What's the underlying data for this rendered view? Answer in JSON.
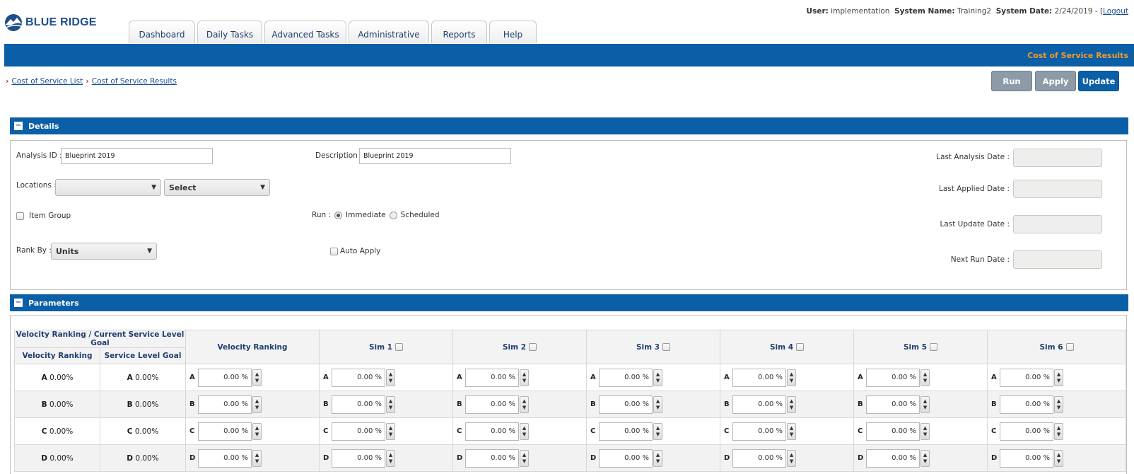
{
  "header": {
    "logo_text": "BLUE RIDGE",
    "user_label": "User:",
    "user_value": "implementation",
    "system_name_label": "System Name:",
    "system_name_value": "Training2",
    "system_date_label": "System Date:",
    "system_date_value": "2/24/2019 - [",
    "logout_label": "Logout",
    "tabs": [
      {
        "label": "Dashboard"
      },
      {
        "label": "Daily Tasks"
      },
      {
        "label": "Advanced Tasks"
      },
      {
        "label": "Administrative"
      },
      {
        "label": "Reports"
      },
      {
        "label": "Help"
      }
    ],
    "page_title": "Cost of Service Results"
  },
  "breadcrumb": [
    {
      "label": "Cost of Service List"
    },
    {
      "label": "Cost of Service Results"
    }
  ],
  "actions": {
    "run": "Run",
    "apply": "Apply",
    "update": "Update"
  },
  "details": {
    "section_title": "Details",
    "collapse_glyph": "−",
    "analysis_id_label": "Analysis ID :",
    "analysis_id_value": "Blueprint 2019",
    "description_label": "Description :",
    "description_value": "Blueprint 2019",
    "locations_label": "Locations :",
    "locations_value_1": "",
    "locations_value_2": "Select",
    "item_group_label": "Item Group",
    "run_label": "Run :",
    "run_immediate": "Immediate",
    "run_scheduled": "Scheduled",
    "rank_by_label": "Rank By :",
    "rank_by_value": "Units",
    "auto_apply_label": "Auto Apply",
    "last_analysis_label": "Last Analysis Date :",
    "last_applied_label": "Last Applied Date :",
    "last_update_label": "Last Update Date :",
    "next_run_label": "Next Run Date :",
    "caret": "▼"
  },
  "parameters": {
    "section_title": "Parameters",
    "group_header": "Velocity Ranking / Current Service Level Goal",
    "col_velocity_ranking": "Velocity Ranking",
    "col_service_level_goal": "Service Level Goal",
    "col_velocity_ranking_input": "Velocity Ranking",
    "sims": [
      {
        "label": "Sim 1"
      },
      {
        "label": "Sim 2"
      },
      {
        "label": "Sim 3"
      },
      {
        "label": "Sim 4"
      },
      {
        "label": "Sim 5"
      },
      {
        "label": "Sim 6"
      }
    ],
    "spinner_up": "▲",
    "spinner_down": "▼",
    "rows": [
      {
        "letter": "A",
        "vr_pct": "0.00%",
        "slg_pct": "0.00%",
        "input_value": "0.00 %"
      },
      {
        "letter": "B",
        "vr_pct": "0.00%",
        "slg_pct": "0.00%",
        "input_value": "0.00 %"
      },
      {
        "letter": "C",
        "vr_pct": "0.00%",
        "slg_pct": "0.00%",
        "input_value": "0.00 %"
      },
      {
        "letter": "D",
        "vr_pct": "0.00%",
        "slg_pct": "0.00%",
        "input_value": "0.00 %"
      }
    ]
  },
  "colors": {
    "brand_blue": "#0a5fa6",
    "accent_orange": "#f39a2b",
    "link_blue": "#1a4f96"
  }
}
